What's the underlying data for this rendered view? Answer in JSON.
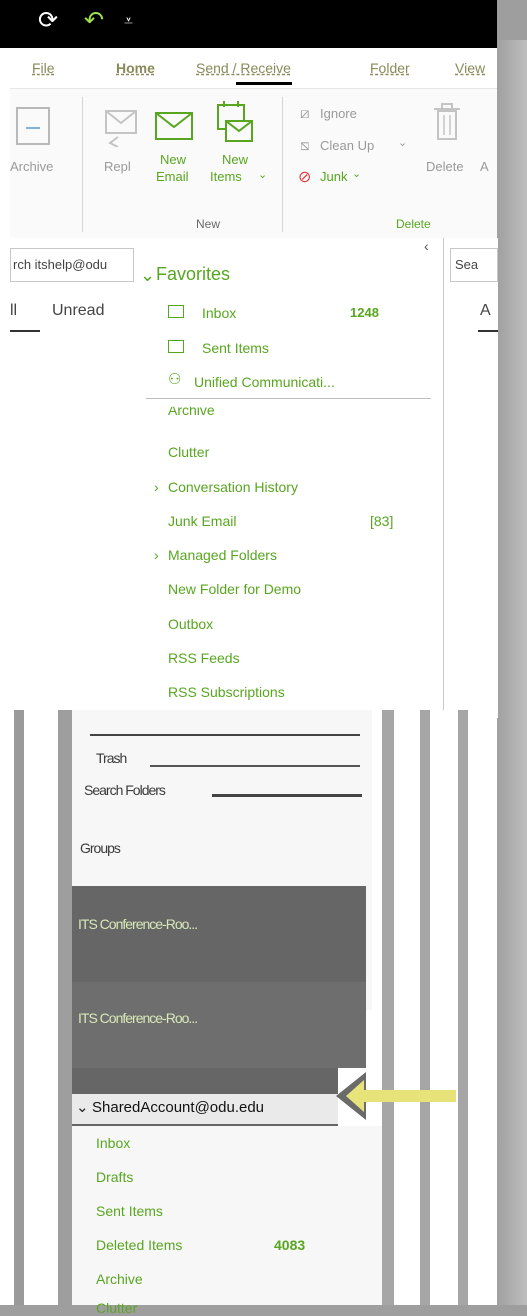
{
  "qat": {
    "sync_icon": "sync-icon",
    "undo_icon": "undo-icon",
    "customize_icon": "customize-qat-icon"
  },
  "menu": {
    "tabs": [
      "File",
      "Home",
      "Send / Receive",
      "Folder",
      "View"
    ]
  },
  "ribbon": {
    "archive_label": "Archive",
    "reply_label": "Repl",
    "new_email_line1": "New",
    "new_email_line2": "Email",
    "new_items_line1": "New",
    "new_items_line2": "Items",
    "new_group_label": "New",
    "ignore_label": "Ignore",
    "cleanup_label": "Clean Up",
    "junk_label": "Junk",
    "delete_label": "Delete",
    "delete_group_label": "Delete",
    "trailing_label": "A"
  },
  "left": {
    "search_placeholder": "rch itshelp@odu",
    "filter_all": "ll",
    "filter_unread": "Unread"
  },
  "right": {
    "search_placeholder": "Sea",
    "filter_all": "A"
  },
  "favorites": {
    "header": "Favorites",
    "items": [
      {
        "label": "Inbox",
        "count": "1248"
      },
      {
        "label": "Sent Items",
        "count": ""
      },
      {
        "label": "Unified Communicati...",
        "count": ""
      }
    ]
  },
  "folders": [
    {
      "label": "Archive",
      "count": ""
    },
    {
      "label": "Clutter",
      "count": ""
    },
    {
      "label": "Conversation History",
      "count": ""
    },
    {
      "label": "Junk Email",
      "count": "[83]"
    },
    {
      "label": "Managed Folders",
      "count": ""
    },
    {
      "label": "New Folder for Demo",
      "count": ""
    },
    {
      "label": "Outbox",
      "count": ""
    },
    {
      "label": "RSS Feeds",
      "count": ""
    },
    {
      "label": "RSS Subscriptions",
      "count": ""
    }
  ],
  "lower_tree": {
    "trash": "Trash",
    "search_folders": "Search Folders",
    "groups": "Groups",
    "conf_room_1": "ITS Conference-Roo...",
    "conf_room_2": "ITS Conference-Roo..."
  },
  "shared_account": {
    "header": "SharedAccount@odu.edu",
    "items": [
      {
        "label": "Inbox",
        "count": ""
      },
      {
        "label": "Drafts",
        "count": ""
      },
      {
        "label": "Sent Items",
        "count": ""
      },
      {
        "label": "Deleted Items",
        "count": "4083"
      },
      {
        "label": "Archive",
        "count": ""
      },
      {
        "label": "Clutter",
        "count": ""
      }
    ]
  },
  "colors": {
    "accent": "#58a620",
    "arrow": "#e8e27a",
    "titlebar": "#000000"
  }
}
